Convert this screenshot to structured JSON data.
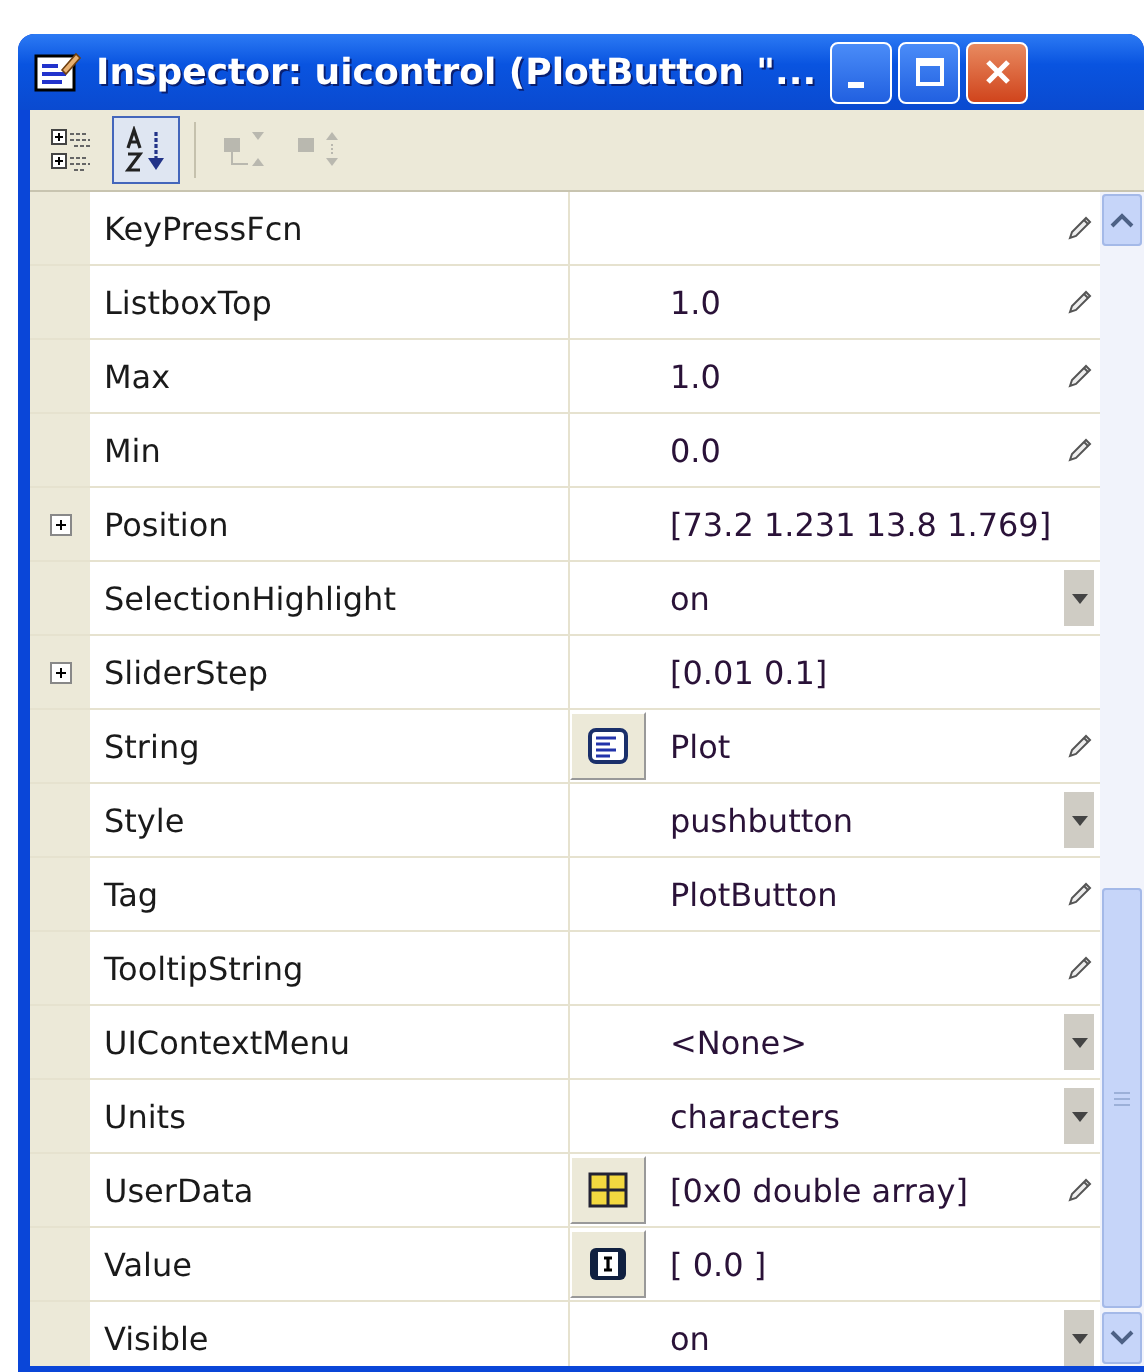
{
  "window": {
    "title": "Inspector:  uicontrol (PlotButton \"..."
  },
  "toolbar": [
    {
      "kind": "categorized",
      "selected": false,
      "disabled": false
    },
    {
      "kind": "sorted",
      "selected": true,
      "disabled": false
    },
    {
      "kind": "expand",
      "selected": false,
      "disabled": true
    },
    {
      "kind": "collapse",
      "selected": false,
      "disabled": true
    }
  ],
  "properties": [
    {
      "kind": "plain",
      "name": "KeyPressFcn",
      "expandable": false,
      "editable": true,
      "dropdown": false
    },
    {
      "kind": "plain",
      "name": "ListboxTop",
      "expandable": false,
      "value": "1.0",
      "editable": true,
      "dropdown": false
    },
    {
      "kind": "plain",
      "name": "Max",
      "expandable": false,
      "value": "1.0",
      "editable": true,
      "dropdown": false
    },
    {
      "kind": "plain",
      "name": "Min",
      "expandable": false,
      "value": "0.0",
      "editable": true,
      "dropdown": false
    },
    {
      "kind": "plain",
      "name": "Position",
      "expandable": true,
      "value": "[73.2 1.231 13.8 1.769]",
      "editable": false,
      "dropdown": false
    },
    {
      "kind": "plain",
      "name": "SelectionHighlight",
      "expandable": false,
      "value": "on",
      "editable": false,
      "dropdown": true
    },
    {
      "kind": "plain",
      "name": "SliderStep",
      "expandable": true,
      "value": "[0.01 0.1]",
      "editable": false,
      "dropdown": false
    },
    {
      "kind": "text",
      "name": "String",
      "expandable": false,
      "value": "Plot",
      "editable": true,
      "dropdown": false
    },
    {
      "kind": "plain",
      "name": "Style",
      "expandable": false,
      "value": "pushbutton",
      "editable": false,
      "dropdown": true
    },
    {
      "kind": "plain",
      "name": "Tag",
      "expandable": false,
      "value": "PlotButton",
      "editable": true,
      "dropdown": false
    },
    {
      "kind": "plain",
      "name": "TooltipString",
      "expandable": false,
      "editable": true,
      "dropdown": false
    },
    {
      "kind": "plain",
      "name": "UIContextMenu",
      "expandable": false,
      "value": "<None>",
      "editable": false,
      "dropdown": true
    },
    {
      "kind": "plain",
      "name": "Units",
      "expandable": false,
      "value": "characters",
      "editable": false,
      "dropdown": true
    },
    {
      "kind": "matrix",
      "name": "UserData",
      "expandable": false,
      "value": "[0x0  double array]",
      "editable": true,
      "dropdown": false
    },
    {
      "kind": "array",
      "name": "Value",
      "expandable": false,
      "value": "[ 0.0 ]",
      "editable": false,
      "dropdown": false
    },
    {
      "kind": "plain",
      "name": "Visible",
      "expandable": false,
      "value": "on",
      "editable": false,
      "dropdown": true
    }
  ]
}
